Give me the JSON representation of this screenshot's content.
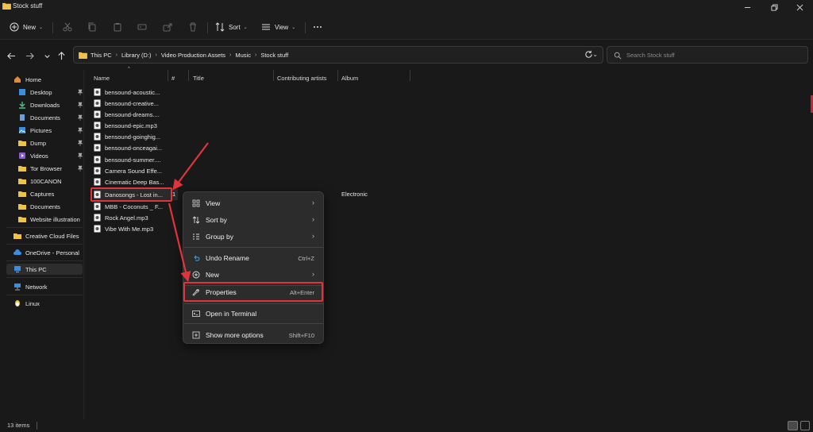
{
  "window": {
    "title": "Stock stuff"
  },
  "toolbar": {
    "new_label": "New",
    "sort_label": "Sort",
    "view_label": "View"
  },
  "address": {
    "crumbs": [
      "This PC",
      "Library (D:)",
      "Video Production Assets",
      "Music",
      "Stock stuff"
    ]
  },
  "search": {
    "placeholder": "Search Stock stuff"
  },
  "sidebar": {
    "home": "Home",
    "quick": [
      "Desktop",
      "Downloads",
      "Documents",
      "Pictures",
      "Dump",
      "Videos",
      "Tor Browser",
      "100CANON",
      "Captures",
      "Documents",
      "Website illustration"
    ],
    "cloud": "Creative Cloud Files",
    "onedrive": "OneDrive - Personal",
    "thispc": "This PC",
    "network": "Network",
    "linux": "Linux"
  },
  "columns": {
    "name": "Name",
    "number": "#",
    "title": "Title",
    "artists": "Contributing artists",
    "album": "Album"
  },
  "files": [
    "bensound-acoustic...",
    "bensound-creative...",
    "bensound-dreams....",
    "bensound-epic.mp3",
    "bensound-goinghig...",
    "bensound-onceagai...",
    "bensound-summer....",
    "Camera Sound Effe...",
    "Cinematic Deep Bas...",
    "Danosongs - Lost in...",
    "MBB - Coconuts _ F...",
    "Rock Angel.mp3",
    "Vibe With Me.mp3"
  ],
  "selected_file": {
    "number": "1",
    "album": "Electronic"
  },
  "context_menu": {
    "view": "View",
    "sort_by": "Sort by",
    "group_by": "Group by",
    "undo_rename": "Undo Rename",
    "undo_shortcut": "Ctrl+Z",
    "new": "New",
    "properties": "Properties",
    "properties_shortcut": "Alt+Enter",
    "open_terminal": "Open in Terminal",
    "show_more": "Show more options",
    "show_more_shortcut": "Shift+F10"
  },
  "status": {
    "count": "13 items"
  },
  "colors": {
    "highlight": "#e0343c",
    "background": "#191919",
    "menu": "#2c2c2c",
    "folder": "#f0c14b"
  },
  "icons": [
    "folder-icon",
    "new-icon",
    "cut-icon",
    "copy-icon",
    "paste-icon",
    "rename-icon",
    "share-icon",
    "delete-icon",
    "sort-icon",
    "view-icon",
    "more-icon",
    "back-icon",
    "forward-icon",
    "up-icon",
    "refresh-icon",
    "search-icon",
    "pin-icon",
    "music-file-icon",
    "wrench-icon",
    "terminal-icon",
    "undo-icon"
  ]
}
